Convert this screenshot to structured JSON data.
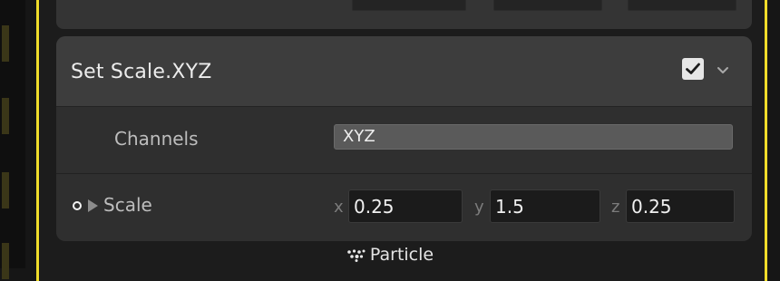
{
  "block": {
    "title": "Set Scale.XYZ",
    "enabled": true,
    "icons": {
      "checkbox": "checkmark-icon",
      "menu": "chevron-down-icon"
    }
  },
  "channels": {
    "label": "Channels",
    "value": "XYZ"
  },
  "scale": {
    "label": "Scale",
    "icons": {
      "port": "input-port-icon",
      "expand": "expand-arrow-icon"
    },
    "x": {
      "axis": "x",
      "value": "0.25"
    },
    "y": {
      "axis": "y",
      "value": "1.5"
    },
    "z": {
      "axis": "z",
      "value": "0.25"
    }
  },
  "context": {
    "label": "Particle",
    "icon": "particle-icon",
    "accent_color": "#f0dc2a"
  }
}
